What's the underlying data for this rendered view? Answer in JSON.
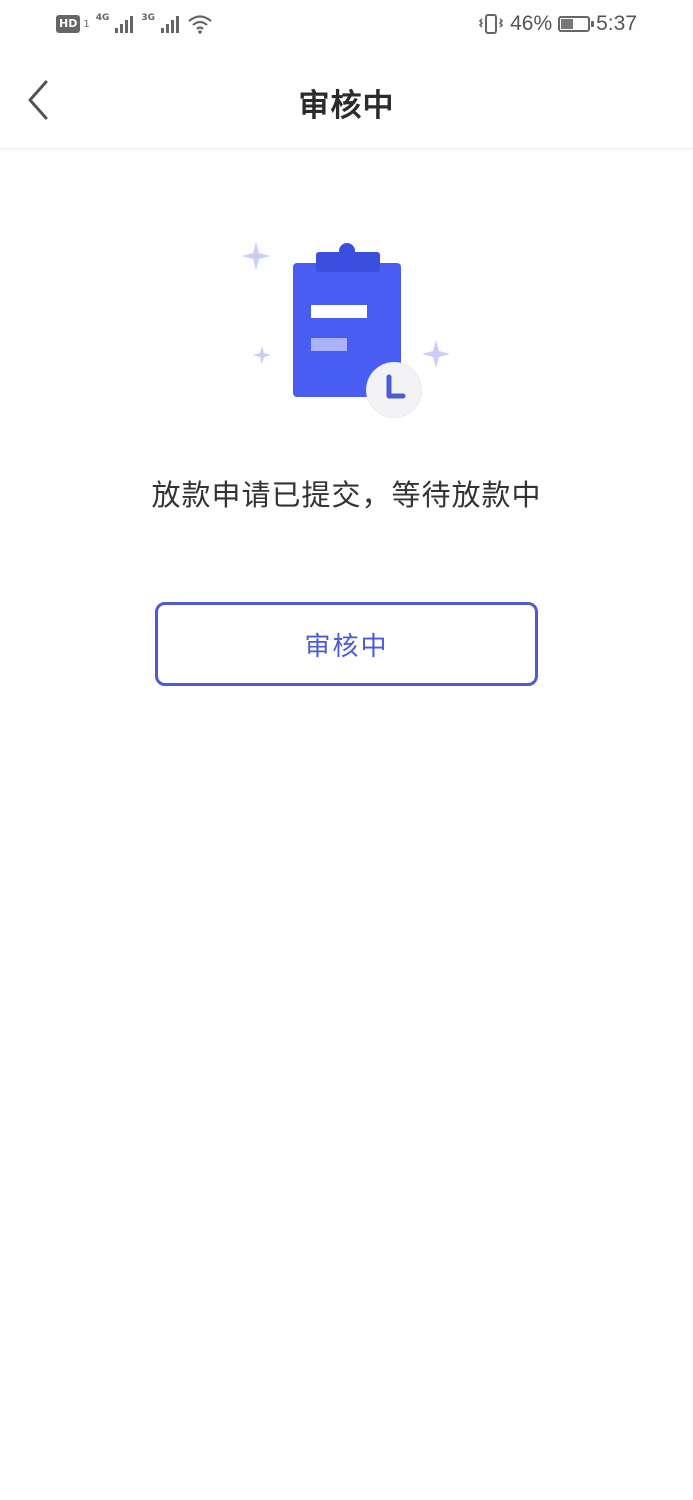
{
  "status_bar": {
    "hd_label": "HD",
    "hd_sim": "1",
    "network_1": "4G",
    "network_2": "3G",
    "battery_percent_text": "46%",
    "battery_level": 0.46,
    "time": "5:37",
    "icons": [
      "hd-icon",
      "signal-icon",
      "wifi-icon",
      "vibrate-icon",
      "battery-icon"
    ]
  },
  "header": {
    "title": "审核中",
    "back_icon": "chevron-left-icon"
  },
  "main": {
    "illustration_icon": "clipboard-clock-icon",
    "message": "放款申请已提交，等待放款中",
    "status_button_label": "审核中"
  },
  "colors": {
    "accent": "#4a5bd4",
    "clipboard": "#4a5df2",
    "sparkle": "#c9cdf7"
  }
}
